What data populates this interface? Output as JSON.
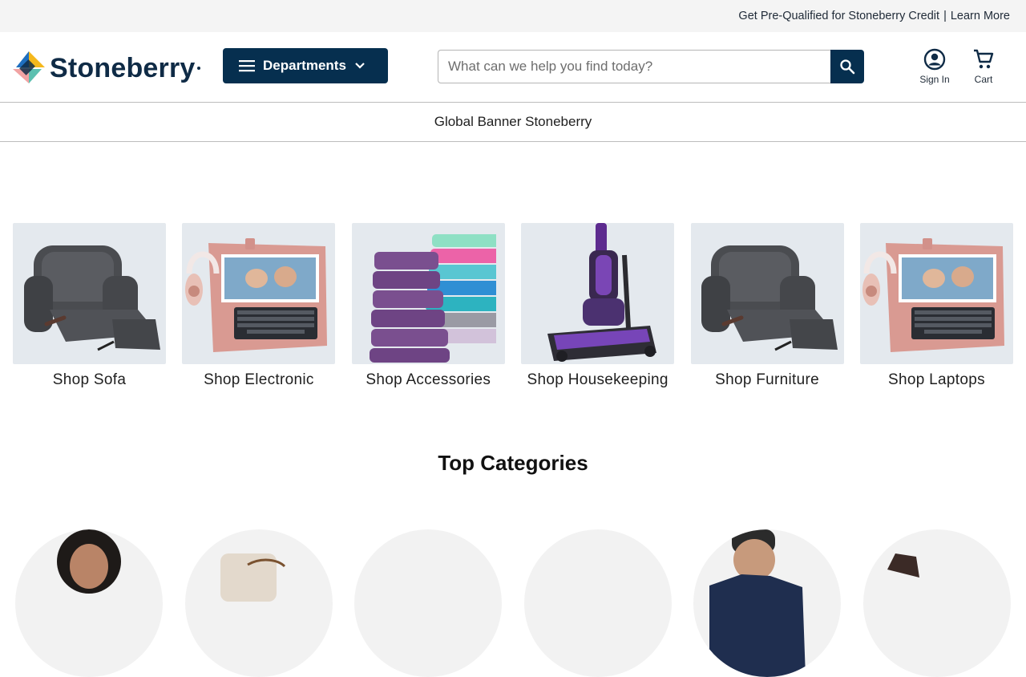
{
  "promo": {
    "credit_text": "Get Pre-Qualified for Stoneberry Credit",
    "separator": "|",
    "learn_more": "Learn More"
  },
  "header": {
    "logo_text": "Stoneberry",
    "departments_label": "Departments",
    "search_placeholder": "What can we help you find today?",
    "sign_in_label": "Sign In",
    "cart_label": "Cart"
  },
  "global_banner": "Global Banner Stoneberry",
  "shop_tiles": [
    {
      "label": "Shop Sofa",
      "image": "recliner"
    },
    {
      "label": "Shop Electronic",
      "image": "tablet-keyboard-headphones"
    },
    {
      "label": "Shop Accessories",
      "image": "towel-stack"
    },
    {
      "label": "Shop Housekeeping",
      "image": "vacuum"
    },
    {
      "label": "Shop Furniture",
      "image": "recliner"
    },
    {
      "label": "Shop Laptops",
      "image": "tablet-keyboard-headphones"
    }
  ],
  "top_categories_title": "Top Categories",
  "colors": {
    "brand_navy": "#062f4f",
    "promo_bg": "#f4f4f4",
    "tile_bg": "#e4e9ee"
  }
}
